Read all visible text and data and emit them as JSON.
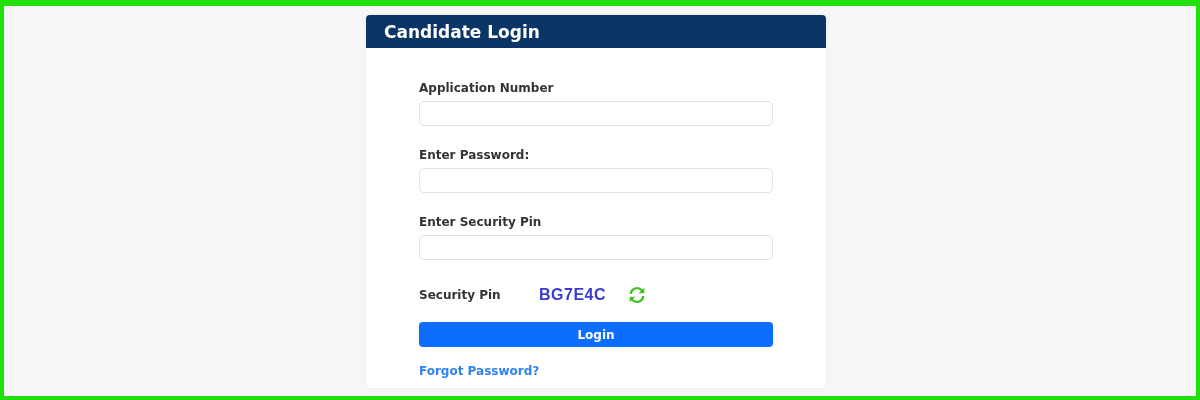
{
  "card": {
    "title": "Candidate Login"
  },
  "fields": [
    {
      "label": "Application Number"
    },
    {
      "label": "Enter Password:"
    },
    {
      "label": "Enter Security Pin"
    }
  ],
  "captcha": {
    "label": "Security Pin",
    "code": "BG7E4C"
  },
  "login_button": "Login",
  "forgot_link": "Forgot Password?"
}
